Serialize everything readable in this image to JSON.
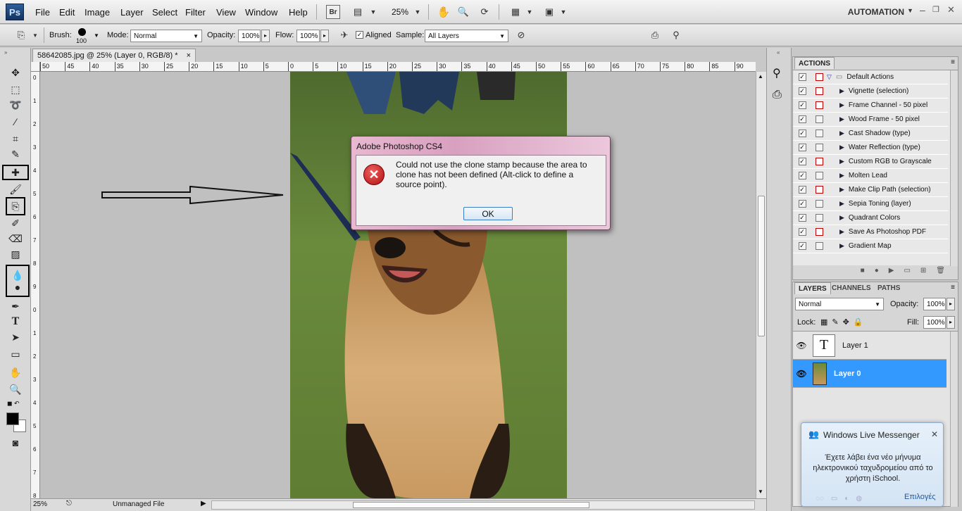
{
  "app": {
    "logo": "Ps"
  },
  "menu": [
    "File",
    "Edit",
    "Image",
    "Layer",
    "Select",
    "Filter",
    "View",
    "Window",
    "Help"
  ],
  "appbar": {
    "br_label": "Br",
    "zoom": "25%",
    "workspace": "AUTOMATION"
  },
  "options": {
    "brush_label": "Brush:",
    "brush_size": "100",
    "mode_label": "Mode:",
    "mode_value": "Normal",
    "opacity_label": "Opacity:",
    "opacity_value": "100%",
    "flow_label": "Flow:",
    "flow_value": "100%",
    "aligned_label": "Aligned",
    "aligned_checked": true,
    "sample_label": "Sample:",
    "sample_value": "All Layers"
  },
  "document": {
    "tab_title": "58642085.jpg @ 25% (Layer 0, RGB/8) *",
    "ruler_h": [
      "50",
      "45",
      "40",
      "35",
      "30",
      "25",
      "20",
      "15",
      "10",
      "5",
      "0",
      "5",
      "10",
      "15",
      "20",
      "25",
      "30",
      "35",
      "40",
      "45",
      "50",
      "55",
      "60",
      "65",
      "70",
      "75",
      "80",
      "85",
      "90"
    ],
    "ruler_v": [
      "0",
      "1",
      "2",
      "3",
      "4",
      "5",
      "6",
      "7",
      "8",
      "9",
      "0",
      "1",
      "2",
      "3",
      "4",
      "5",
      "6",
      "7",
      "8",
      "9"
    ]
  },
  "status": {
    "zoom": "25%",
    "info": "Unmanaged File"
  },
  "dialog": {
    "title": "Adobe Photoshop CS4",
    "message": "Could not use the clone stamp because the area to clone has not been defined (Alt-click to define a source point).",
    "ok_label": "OK"
  },
  "actions_panel": {
    "tab": "ACTIONS",
    "set_name": "Default Actions",
    "items": [
      {
        "name": "Vignette (selection)",
        "dialog": true
      },
      {
        "name": "Frame Channel - 50 pixel",
        "dialog": true
      },
      {
        "name": "Wood Frame - 50 pixel",
        "dialog": false
      },
      {
        "name": "Cast Shadow (type)",
        "dialog": false
      },
      {
        "name": "Water Reflection (type)",
        "dialog": false
      },
      {
        "name": "Custom RGB to Grayscale",
        "dialog": true
      },
      {
        "name": "Molten Lead",
        "dialog": false
      },
      {
        "name": "Make Clip Path (selection)",
        "dialog": true
      },
      {
        "name": "Sepia Toning (layer)",
        "dialog": false
      },
      {
        "name": "Quadrant Colors",
        "dialog": false
      },
      {
        "name": "Save As Photoshop PDF",
        "dialog": true
      },
      {
        "name": "Gradient Map",
        "dialog": false
      }
    ]
  },
  "layers_panel": {
    "tabs": [
      "LAYERS",
      "CHANNELS",
      "PATHS"
    ],
    "blend_mode": "Normal",
    "opacity_label": "Opacity:",
    "opacity_value": "100%",
    "lock_label": "Lock:",
    "fill_label": "Fill:",
    "fill_value": "100%",
    "layers": [
      {
        "name": "Layer 1",
        "thumb": "T",
        "selected": false
      },
      {
        "name": "Layer 0",
        "thumb": "",
        "selected": true
      }
    ]
  },
  "messenger": {
    "title": "Windows Live Messenger",
    "body": "Έχετε λάβει ένα νέο μήνυμα ηλεκτρονικού ταχυδρομείου από το χρήστη iSchool.",
    "link": "Επιλογές"
  },
  "colors": {
    "selection": "#3399ff",
    "ps_blue": "#1e4477"
  }
}
